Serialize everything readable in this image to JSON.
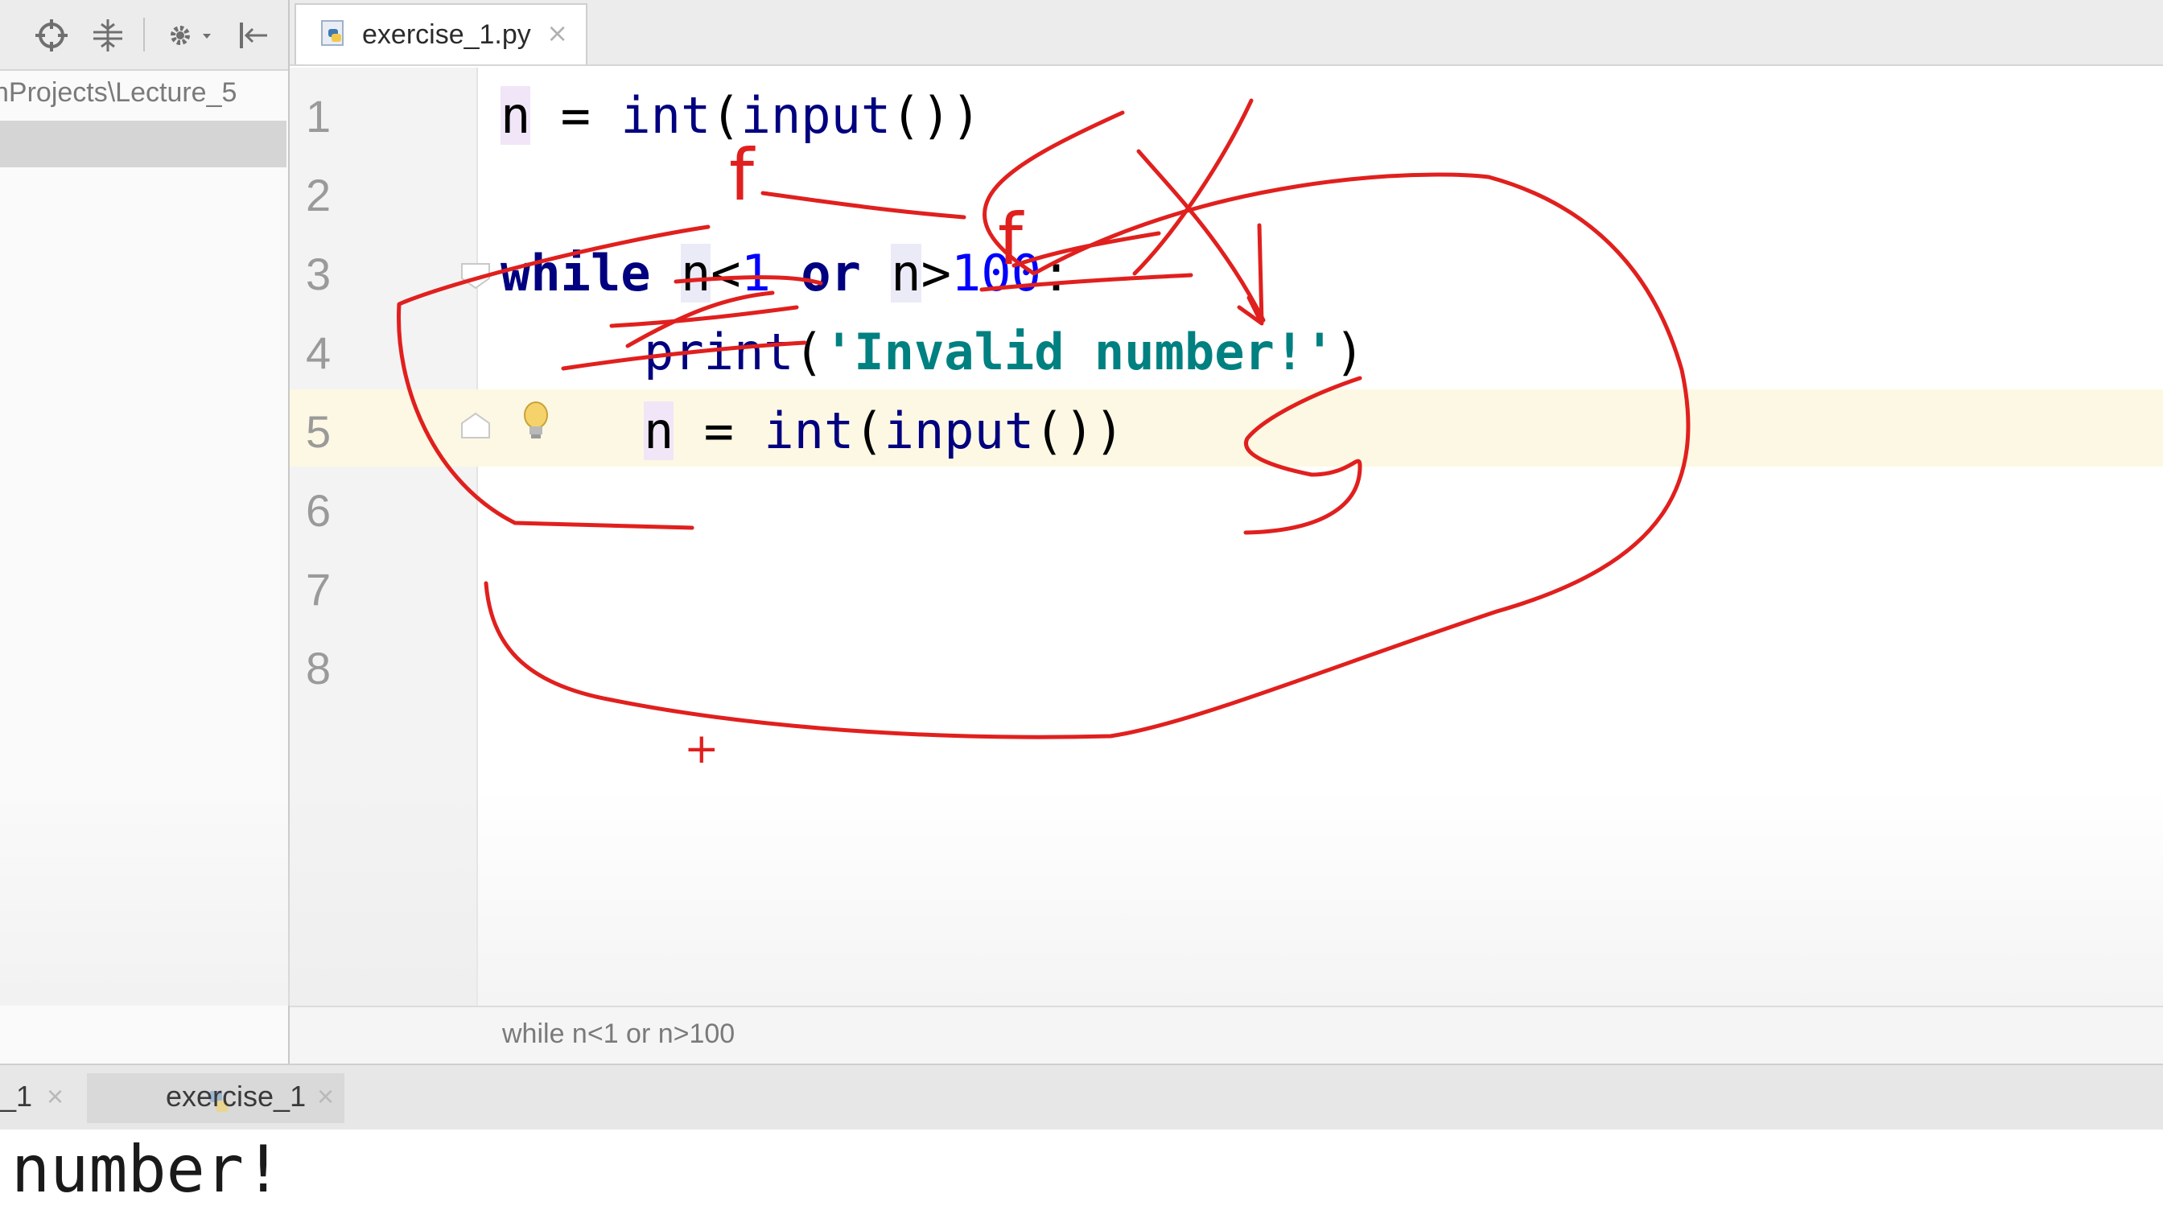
{
  "left_panel": {
    "project_path": "nProjects\\Lecture_5",
    "toolbar_icons": [
      "crosshair-icon",
      "collapse-icon",
      "gear-icon",
      "hide-panel-icon"
    ]
  },
  "editor": {
    "tab_label": "exercise_1.py",
    "tab_close": "×",
    "line_numbers": [
      "1",
      "2",
      "3",
      "4",
      "5",
      "6",
      "7",
      "8"
    ],
    "current_line": 5,
    "code": {
      "line1": {
        "var": "n",
        "op": " = ",
        "fn": "int",
        "p1": "(",
        "fn2": "input",
        "p2": "())"
      },
      "line3": {
        "kw": "while",
        "sp": " ",
        "var1": "n",
        "op1": "<",
        "n1": "1",
        "sp2": " ",
        "kw2": "or",
        "sp3": " ",
        "var2": "n",
        "op2": ">",
        "n2": "100",
        "colon": ":"
      },
      "line4": {
        "fn": "print",
        "p1": "(",
        "str": "'Invalid number!'",
        "p2": ")"
      },
      "line5": {
        "var": "n",
        "op": " = ",
        "fn": "int",
        "p1": "(",
        "fn2": "input",
        "p2": "())"
      }
    }
  },
  "breadcrumb": "while n<1 or n>100",
  "run_tabs": [
    {
      "label": "_1",
      "close": "×"
    },
    {
      "label": "exercise_1",
      "close": "×"
    }
  ],
  "console_output": "number!",
  "annotations": {
    "marks": [
      "f",
      "f"
    ],
    "cursor": "+",
    "ink_color": "#e0201e"
  }
}
